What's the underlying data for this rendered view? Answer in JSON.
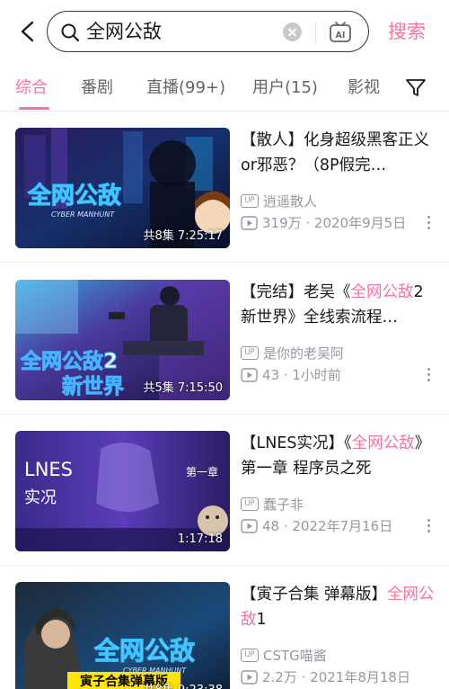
{
  "header": {
    "query": "全网公敌",
    "search_label": "搜索"
  },
  "tabs": [
    {
      "label": "综合",
      "active": true
    },
    {
      "label": "番剧"
    },
    {
      "label": "直播(99+)"
    },
    {
      "label": "用户(15)"
    },
    {
      "label": "影视"
    }
  ],
  "colors": {
    "accent": "#fb7299",
    "meta": "#9499a0"
  },
  "results": [
    {
      "title_pre": "【散人】化身超级黑客正义or邪恶？（8P假完…",
      "title_hl": "",
      "title_post": "",
      "thumb_text": "全网公敌",
      "thumb_sub": "CYBER MANHUNT",
      "duration": "共8集 7:25:17",
      "up_badge": "UP",
      "uploader": "逍遥散人",
      "stats": "319万 · 2020年9月5日"
    },
    {
      "title_pre": "【完结】老吴《",
      "title_hl": "全网公敌",
      "title_post": "2 新世界》全线索流程…",
      "thumb_text": "全网公敌2",
      "thumb_sub": "新世界",
      "duration": "共5集 7:15:50",
      "up_badge": "UP",
      "uploader": "是你的老吴阿",
      "stats": "43 · 1小时前"
    },
    {
      "title_pre": "【LNES实况】《",
      "title_hl": "全网公敌",
      "title_post": "》第一章 程序员之死",
      "thumb_text": "LNES",
      "thumb_sub": "实况",
      "thumb_chapter": "第一章",
      "duration": "1:17:18",
      "up_badge": "UP",
      "uploader": "蠢子非",
      "stats": "48 · 2022年7月16日"
    },
    {
      "title_pre": "【寅子合集 弹幕版】",
      "title_hl": "全网公敌",
      "title_post": "1",
      "thumb_text": "全网公敌",
      "thumb_sub": "CYBER MANHUNT",
      "thumb_badge": "寅子合集弹幕版",
      "duration": "共8集 9:23:38",
      "up_badge": "UP",
      "uploader": "CSTG喵酱",
      "stats": "2.2万 · 2021年8月18日"
    }
  ]
}
